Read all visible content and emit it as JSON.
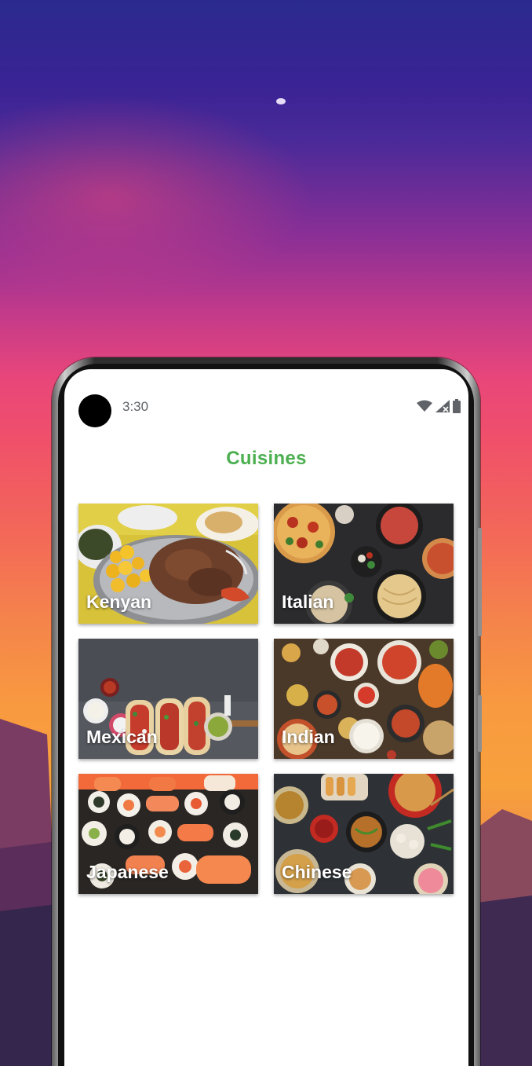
{
  "status_bar": {
    "time": "3:30"
  },
  "header": {
    "title": "Cuisines"
  },
  "cuisines": [
    {
      "label": "Kenyan"
    },
    {
      "label": "Italian"
    },
    {
      "label": "Mexican"
    },
    {
      "label": "Indian"
    },
    {
      "label": "Japanese"
    },
    {
      "label": "Chinese"
    }
  ],
  "colors": {
    "title_green": "#4caf50",
    "label_text": "#ffffff",
    "screen_bg": "#ffffff"
  },
  "icons": [
    "wifi-icon",
    "signal-icon",
    "battery-icon"
  ]
}
